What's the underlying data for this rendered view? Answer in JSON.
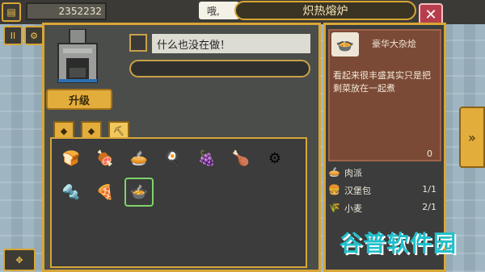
{
  "hud": {
    "money": "2352232",
    "speech": "哦,"
  },
  "window": {
    "title": "炽热熔炉",
    "close_label": "✕"
  },
  "left_buttons": [
    {
      "icon": "pause-icon",
      "glyph": "⏸"
    },
    {
      "icon": "settings-icon",
      "glyph": "⚙"
    },
    {
      "icon": "move-icon",
      "glyph": "✥"
    }
  ],
  "furnace": {
    "upgrade_label": "升级",
    "status_text": "什么也没在做！",
    "progress": 0
  },
  "tabs": [
    {
      "icon": "bread-tab-icon",
      "glyph": "◆",
      "active": false
    },
    {
      "icon": "ore-tab-icon",
      "glyph": "◆",
      "active": false
    },
    {
      "icon": "pickaxe-tab-icon",
      "glyph": "⛏",
      "active": true
    }
  ],
  "inventory": [
    {
      "name": "bread-item",
      "glyph": "🍞"
    },
    {
      "name": "meat-item",
      "glyph": "🍖"
    },
    {
      "name": "pie-item",
      "glyph": "🥧"
    },
    {
      "name": "egg-item",
      "glyph": "🍳"
    },
    {
      "name": "berries-item",
      "glyph": "🍇"
    },
    {
      "name": "ham-item",
      "glyph": "🍗"
    },
    {
      "name": "nut-item",
      "glyph": "⚙"
    },
    {
      "name": "bolt-item",
      "glyph": "🔩"
    },
    {
      "name": "pizza-item",
      "glyph": "🍕"
    },
    {
      "name": "stew-item",
      "glyph": "🍲",
      "selected": true
    }
  ],
  "detail": {
    "dish_icon": "stew-bowl-icon",
    "dish_glyph": "🍲",
    "dish_name": "豪华大杂烩",
    "description": "看起来很丰盛其实只是把剩菜放在一起煮",
    "count": "0",
    "ingredients": [
      {
        "icon": "pie-icon",
        "glyph": "🥧",
        "name": "肉派",
        "qty": ""
      },
      {
        "icon": "burger-icon",
        "glyph": "🍔",
        "name": "汉堡包",
        "qty": "1/1"
      },
      {
        "icon": "wheat-icon",
        "glyph": "🌾",
        "name": "小麦",
        "qty": "2/1"
      }
    ]
  },
  "watermark": {
    "text": "谷普软件园"
  },
  "colors": {
    "accent": "#d8a636",
    "panel": "#4b4d4b",
    "card": "#7b4a36",
    "close": "#b83d4b"
  }
}
